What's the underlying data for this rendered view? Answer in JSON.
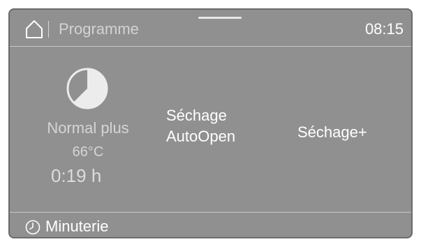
{
  "header": {
    "title": "Programme",
    "clock": "08:15",
    "home_icon": "home-icon"
  },
  "program": {
    "name": "Normal plus",
    "temperature": "66°C",
    "time": "0:19 h",
    "icon": "pie-progress-icon"
  },
  "options": {
    "drying_autoopen_line1": "Séchage",
    "drying_autoopen_line2": "AutoOpen",
    "drying_plus": "Séchage+"
  },
  "footer": {
    "label": "Minuterie",
    "icon": "timer-icon"
  },
  "colors": {
    "screen_bg": "#909090",
    "text_primary": "#ffffff",
    "text_muted": "#d5d5d5"
  }
}
